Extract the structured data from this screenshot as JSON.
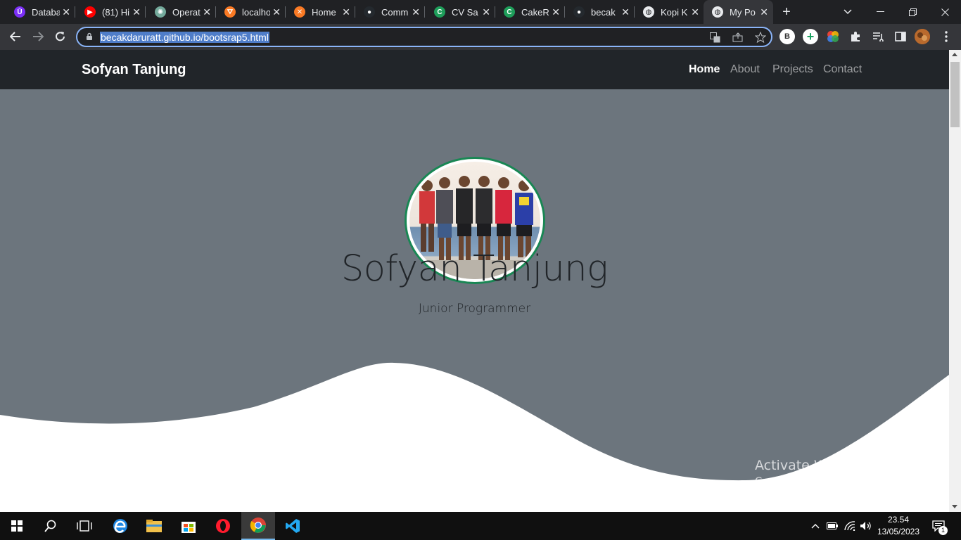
{
  "browser": {
    "tabs": [
      {
        "title": "Database",
        "icon": "database-icon",
        "color": "#7b2ff7",
        "glyph": "Ū"
      },
      {
        "title": "(81) Hi",
        "icon": "youtube-icon",
        "color": "#ff0000",
        "glyph": "▶"
      },
      {
        "title": "Operat",
        "icon": "chatgpt-icon",
        "color": "#74aa9c",
        "glyph": "✺"
      },
      {
        "title": "localho",
        "icon": "xampp-localhost-icon",
        "color": "#fb7a24",
        "glyph": "⛛"
      },
      {
        "title": "Home",
        "icon": "xampp-icon",
        "color": "#fb7a24",
        "glyph": "✕"
      },
      {
        "title": "Comm",
        "icon": "github-icon",
        "color": "#24292e",
        "glyph": "●"
      },
      {
        "title": "CV Sa",
        "icon": "codeigniter-c-icon",
        "color": "#1e9e5a",
        "glyph": "C"
      },
      {
        "title": "CakeR",
        "icon": "codeigniter-c-icon",
        "color": "#1e9e5a",
        "glyph": "C"
      },
      {
        "title": "becak",
        "icon": "github-icon",
        "color": "#24292e",
        "glyph": "●"
      },
      {
        "title": "Kopi K",
        "icon": "globe-icon",
        "color": "#e8eaed",
        "glyph": "◍"
      },
      {
        "title": "My Po",
        "icon": "globe-icon",
        "color": "#e8eaed",
        "glyph": "◍"
      }
    ],
    "new_tab": "+",
    "url": "becakdaruratt.github.io/bootsrap5.html",
    "profile_initial": "B"
  },
  "site": {
    "brand": "Sofyan Tanjung",
    "nav": [
      {
        "label": "Home",
        "active": true
      },
      {
        "label": "About",
        "active": false
      },
      {
        "label": "Projects",
        "active": false
      },
      {
        "label": "Contact",
        "active": false
      }
    ],
    "hero": {
      "name": "Sofyan Tanjung",
      "subtitle": "Junior Programmer",
      "image_alt": "group photo"
    }
  },
  "watermark": {
    "line1": "Activate Windows",
    "line2": "Go to Settings to activate Windows."
  },
  "taskbar": {
    "time": "23.54",
    "date": "13/05/2023",
    "notifications": "1"
  },
  "colors": {
    "navbar": "#212529",
    "hero": "#6c757d",
    "avatar_border": "#198754",
    "omnibox_focus": "#8ab4f8"
  }
}
